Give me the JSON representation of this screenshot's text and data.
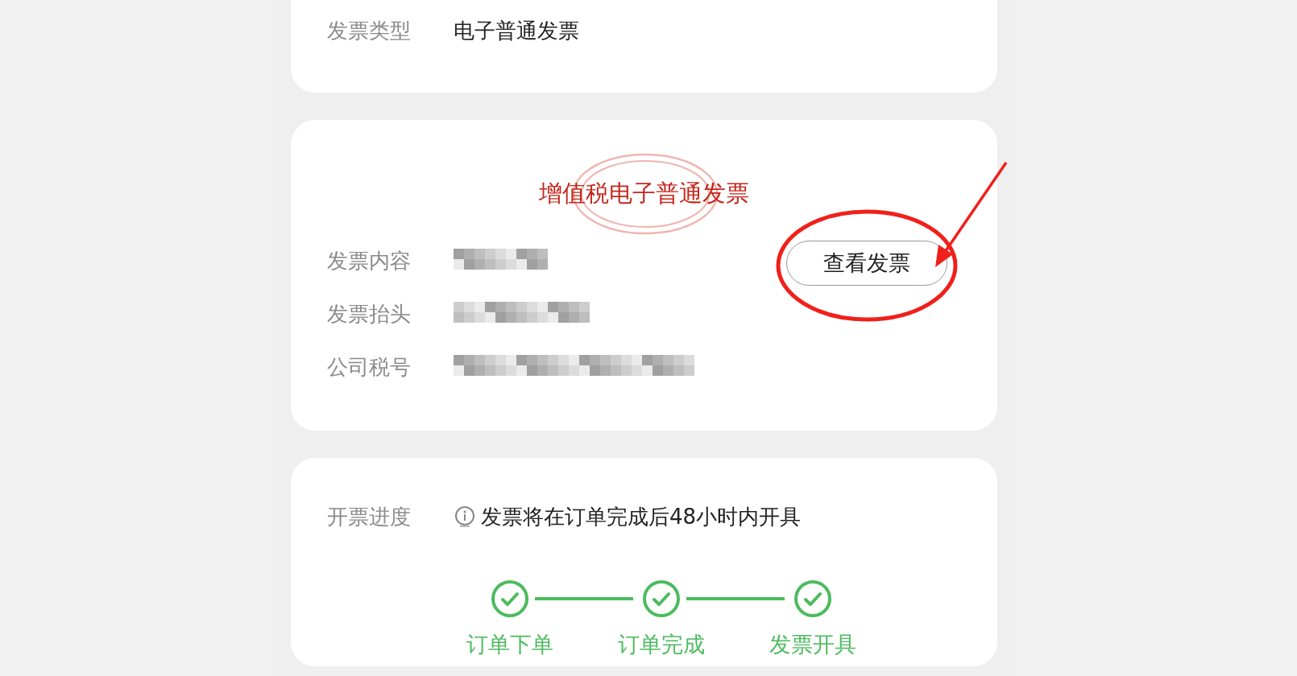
{
  "invoice_type_card": {
    "label": "发票类型",
    "value": "电子普通发票"
  },
  "invoice_card": {
    "title": "增值税电子普通发票",
    "rows": [
      {
        "label": "发票内容",
        "kind": "redacted"
      },
      {
        "label": "发票抬头",
        "kind": "redacted"
      },
      {
        "label": "公司税号",
        "kind": "redacted"
      }
    ],
    "view_button": "查看发票"
  },
  "progress_card": {
    "label": "开票进度",
    "notice": "发票将在订单完成后48小时内开具",
    "steps": [
      {
        "label": "订单下单",
        "done": true
      },
      {
        "label": "订单完成",
        "done": true
      },
      {
        "label": "发票开具",
        "done": true
      }
    ]
  }
}
